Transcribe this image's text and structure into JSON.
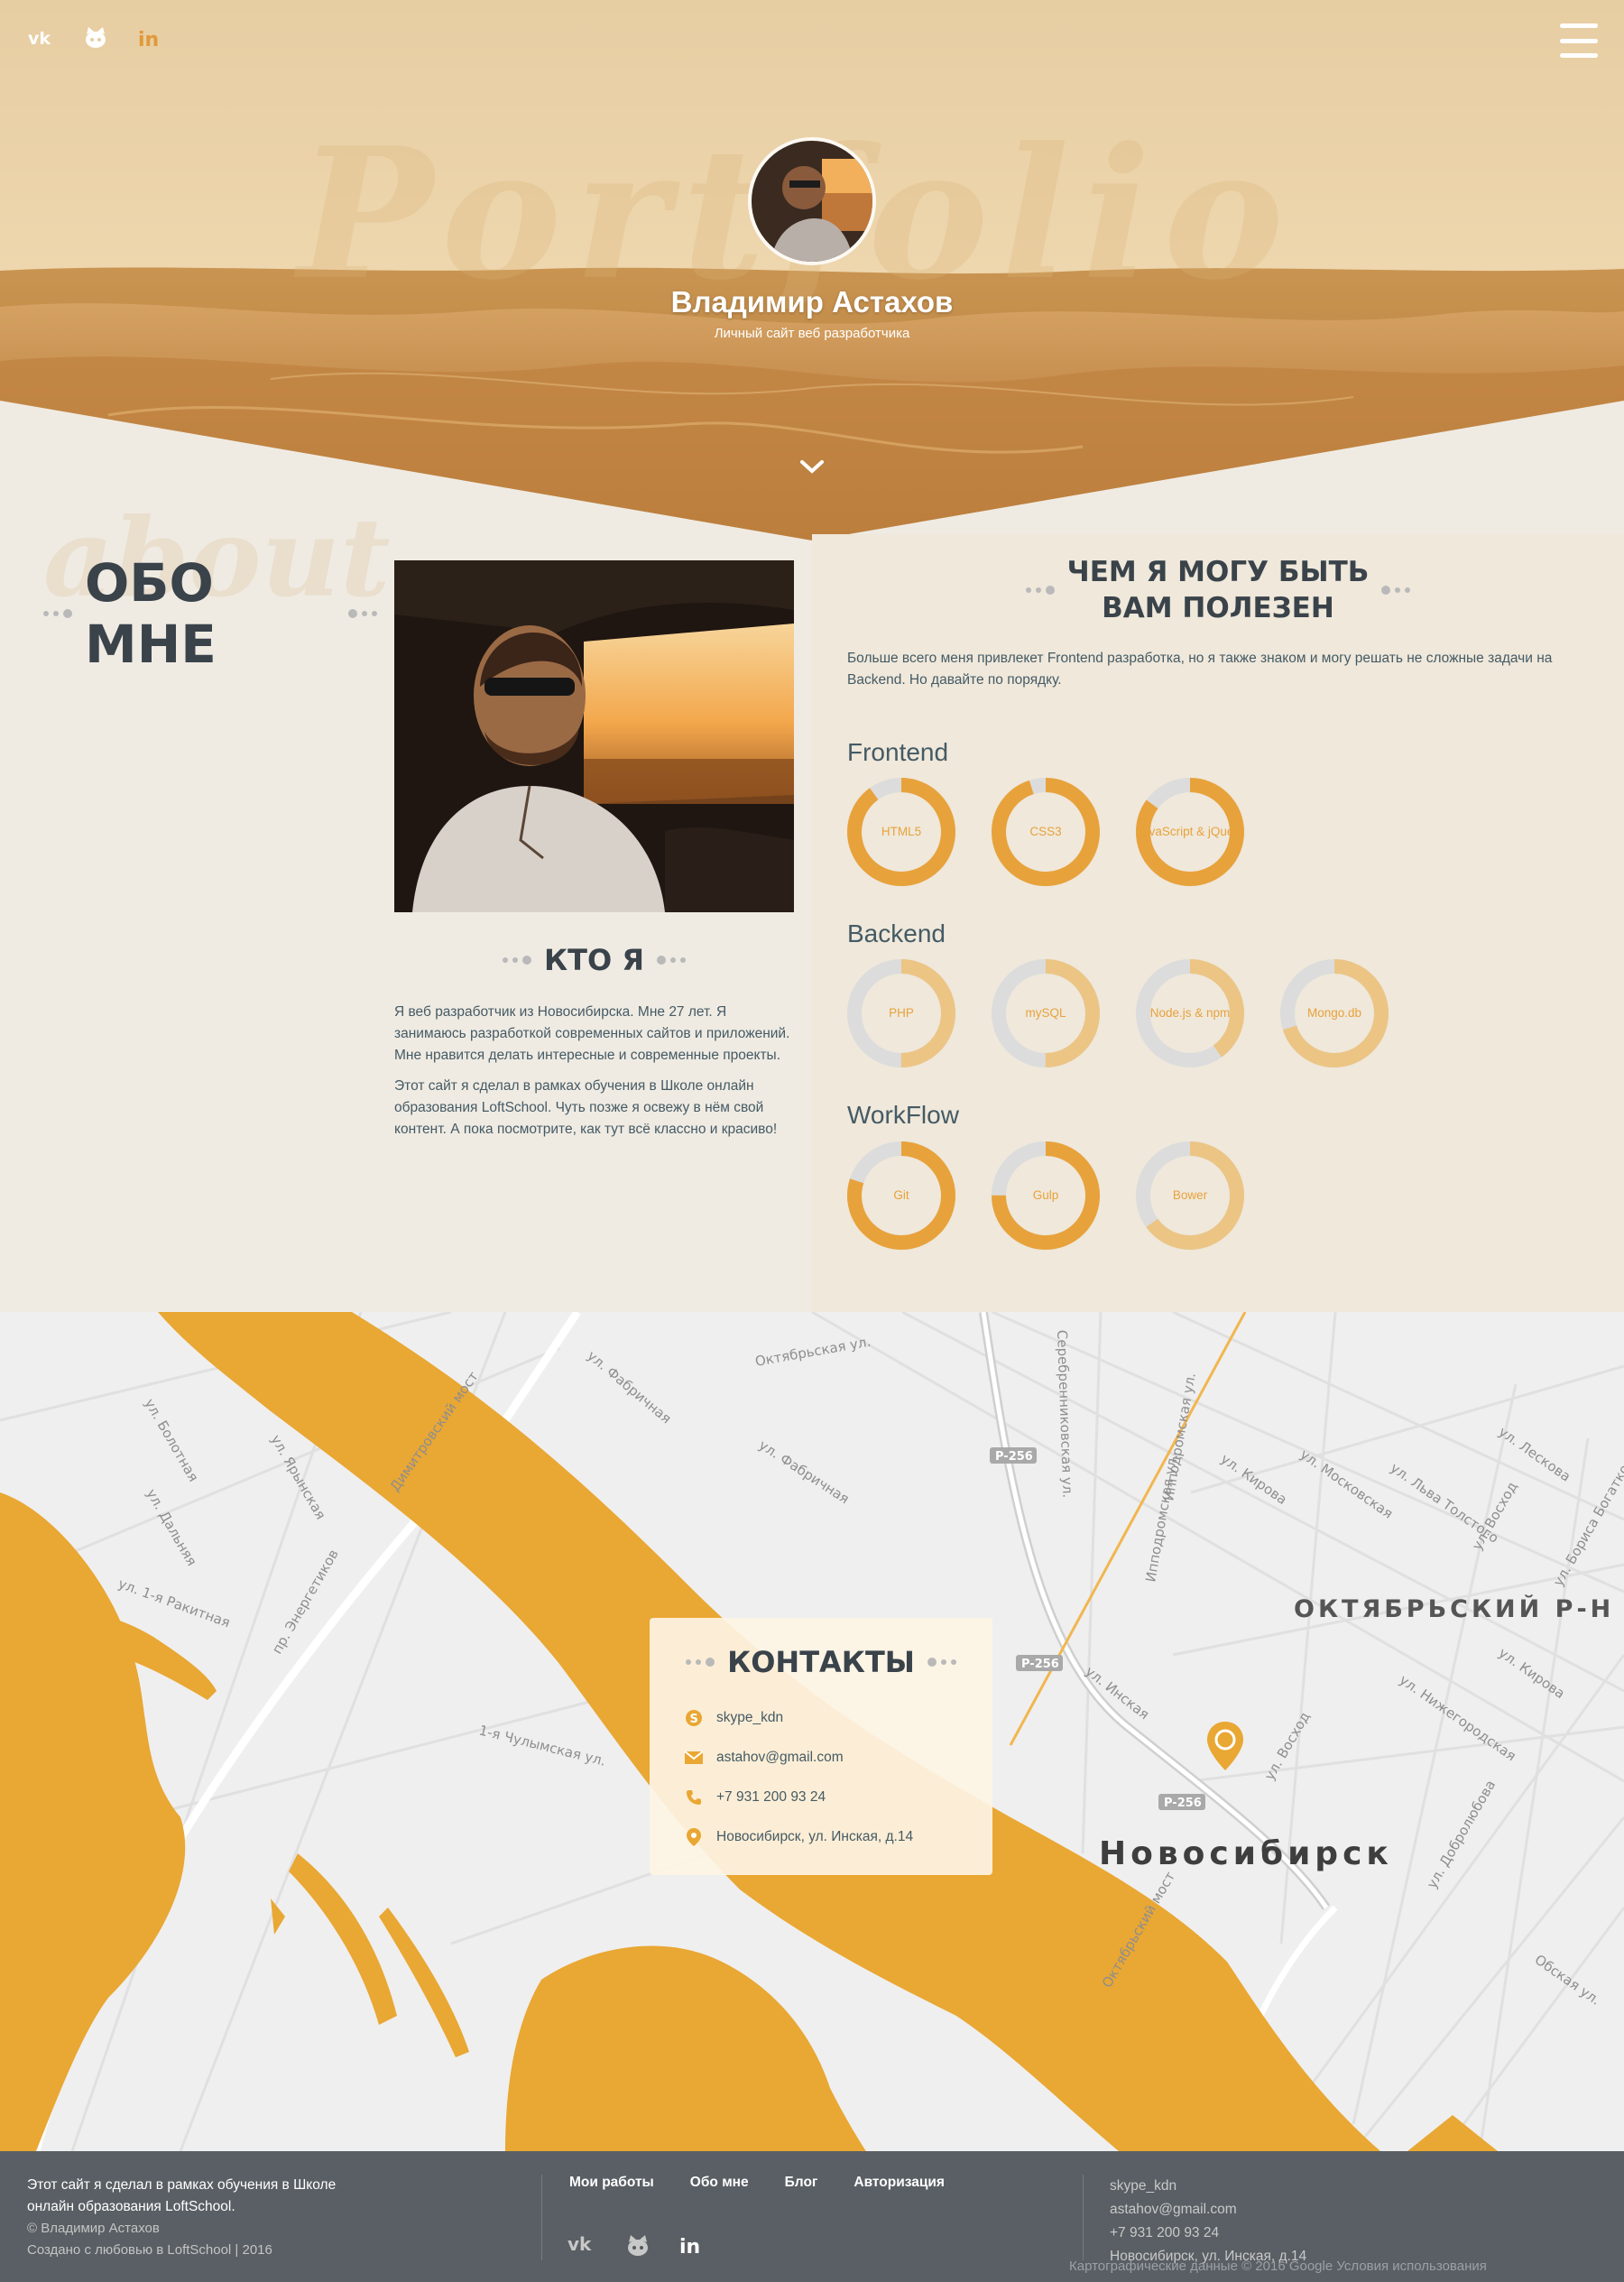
{
  "hero": {
    "name": "Владимир Астахов",
    "subtitle": "Личный сайт веб разработчика",
    "watermark": "Portfolio",
    "social": [
      "vk-icon",
      "github-icon",
      "linkedin-icon"
    ]
  },
  "about": {
    "watermark": "about",
    "title": "ОБО МНЕ",
    "who_title": "КТО Я",
    "paragraph1": "Я веб разработчик из Новосибирска. Мне 27 лет. Я занимаюсь разработкой современных сайтов и приложений. Мне нравится делать интересные и современные проекты.",
    "paragraph2": "Этот сайт я сделал в рамках обучения в Школе онлайн образования LoftSchool. Чуть позже я освежу в нём свой контент. А пока посмотрите, как тут всё классно и красиво!"
  },
  "skills": {
    "title_line1": "ЧЕМ Я МОГУ БЫТЬ",
    "title_line2": "ВАМ ПОЛЕЗЕН",
    "intro": "Больше всего меня привлекет Frontend разработка, но я также знаком и могу решать не сложные задачи на Backend. Но давайте по порядку.",
    "groups": [
      {
        "title": "Frontend",
        "items": [
          {
            "label": "HTML5",
            "level": 0.9
          },
          {
            "label": "CSS3",
            "level": 0.95
          },
          {
            "label": "JavaScript & jQuery",
            "level": 0.85
          }
        ]
      },
      {
        "title": "Backend",
        "items": [
          {
            "label": "PHP",
            "level": 0.5
          },
          {
            "label": "mySQL",
            "level": 0.5
          },
          {
            "label": "Node.js & npm",
            "level": 0.4
          },
          {
            "label": "Mongo.db",
            "level": 0.7
          }
        ]
      },
      {
        "title": "WorkFlow",
        "items": [
          {
            "label": "Git",
            "level": 0.8
          },
          {
            "label": "Gulp",
            "level": 0.75
          },
          {
            "label": "Bower",
            "level": 0.65
          }
        ]
      }
    ]
  },
  "map": {
    "city": "Новосибирск",
    "district": "ОКТЯБРЬСКИЙ Р-Н",
    "streets": [
      "Октябрьская ул.",
      "ул. Фабричная",
      "Серебренниковская ул.",
      "Ипподромская ул.",
      "ул. Кирова",
      "ул. Московская",
      "ул. Льва Толстого",
      "ул. Инская",
      "1-я Чулымская ул.",
      "Октябрьский мост",
      "Димитровский мост",
      "пр. Энергетиков",
      "ул. Болотная",
      "ул. Дальняя",
      "P-256",
      "ул. Лескова",
      "ул. Восход",
      "ул. Бориса Богаткова",
      "ул. Нижегородская",
      "ул. Добролюбова",
      "Обская ул."
    ],
    "copyright": "Картографические данные © 2016 Google    Условия использования"
  },
  "contacts": {
    "title": "КОНТАКТЫ",
    "skype": "skype_kdn",
    "email": "astahov@gmail.com",
    "phone": "+7 931 200 93 24",
    "address": "Новосибирск, ул. Инская, д.14"
  },
  "footer": {
    "text_line1": "Этот сайт я сделал в рамках обучения в Школе",
    "text_line2": "онлайн образования LoftSchool.",
    "copyright": "© Владимир Астахов",
    "made_with": "Создано с любовью в LoftSchool | 2016",
    "nav": [
      "Мои работы",
      "Обо мне",
      "Блог",
      "Авторизация"
    ],
    "skype": "skype_kdn",
    "email": "astahov@gmail.com",
    "phone": "+7 931 200 93 24",
    "address": "Новосибирск, ул. Инская, д.14"
  },
  "colors": {
    "accent": "#e8a23b",
    "accent_light": "#ecc585",
    "track": "#dcdcdc",
    "dark_text": "#3a434a",
    "body_text": "#455a64",
    "footer_bg": "#4e545a"
  }
}
